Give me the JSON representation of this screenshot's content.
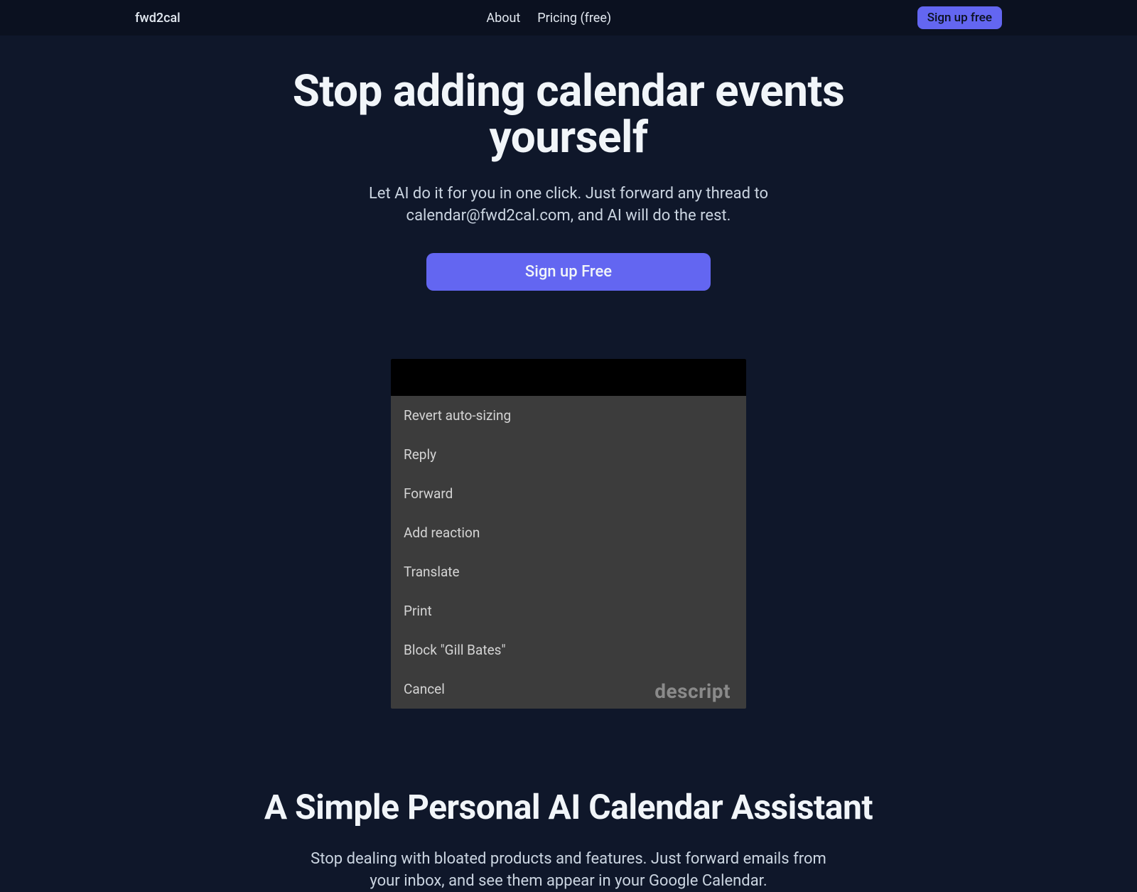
{
  "nav": {
    "brand": "fwd2cal",
    "about": "About",
    "pricing": "Pricing (free)",
    "signup": "Sign up free"
  },
  "hero": {
    "title_line1": "Stop adding calendar events",
    "title_line2": "yourself",
    "sub_line1": "Let AI do it for you in one click. Just forward any thread to",
    "sub_line2": "calendar@fwd2cal.com, and AI will do the rest.",
    "cta": "Sign up Free"
  },
  "demo": {
    "items": [
      "Revert auto-sizing",
      "Reply",
      "Forward",
      "Add reaction",
      "Translate",
      "Print",
      "Block \"Gill Bates\"",
      "Cancel"
    ],
    "watermark": "descript"
  },
  "section2": {
    "title": "A Simple Personal AI Calendar Assistant",
    "sub_line1": "Stop dealing with bloated products and features. Just forward emails from",
    "sub_line2": "your inbox, and see them appear in your Google Calendar."
  }
}
